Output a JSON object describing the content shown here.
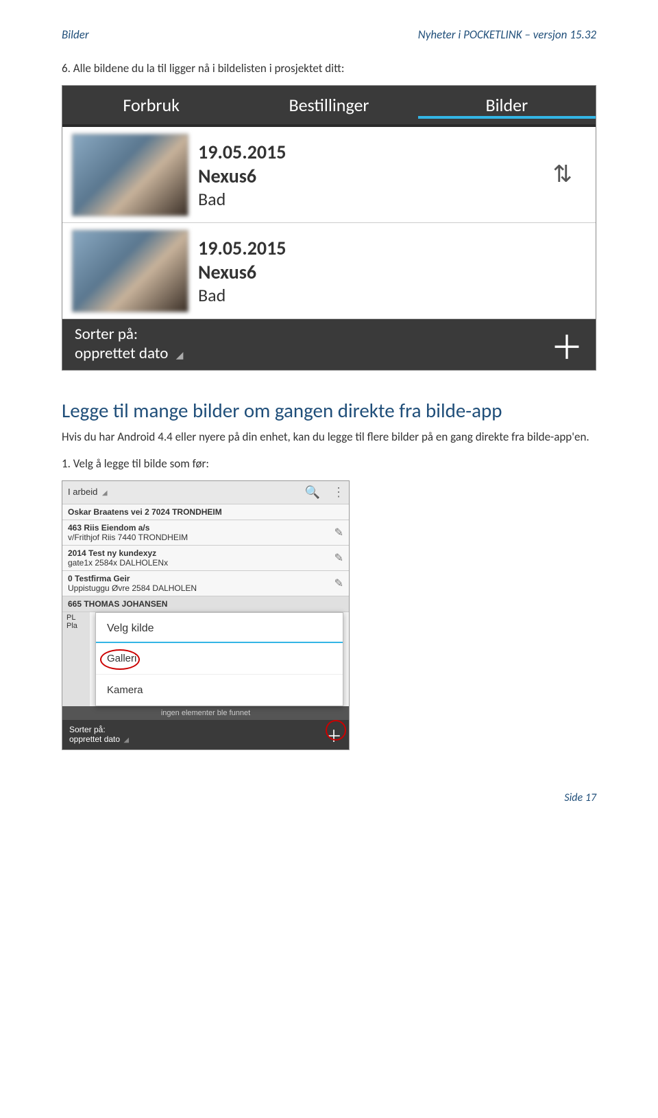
{
  "header": {
    "left": "Bilder",
    "right": "Nyheter i POCKETLINK – versjon 15.32"
  },
  "step6": "6.   Alle bildene du la til ligger nå i bildelisten i prosjektet ditt:",
  "screenshot1": {
    "tabs": {
      "t1": "Forbruk",
      "t2": "Bestillinger",
      "t3": "Bilder"
    },
    "items": [
      {
        "date": "19.05.2015",
        "device": "Nexus6",
        "room": "Bad"
      },
      {
        "date": "19.05.2015",
        "device": "Nexus6",
        "room": "Bad"
      }
    ],
    "sort_icon": "⇅",
    "footer": {
      "sort_label_line1": "Sorter på:",
      "sort_label_line2": "opprettet dato",
      "plus": "＋"
    }
  },
  "heading": "Legge til mange bilder om gangen direkte fra bilde-app",
  "para": "Hvis du har Android 4.4 eller nyere på din enhet, kan du legge til flere bilder på en gang direkte fra bilde-app'en.",
  "step1": "1.   Velg å legge til bilde som før:",
  "screenshot2": {
    "status": "I arbeid",
    "rows": [
      {
        "line1": "Oskar Braatens vei 2  7024  TRONDHEIM",
        "line2": ""
      },
      {
        "line1": "463  Riis Eiendom a/s",
        "line2": "v/Frithjof Riis  7440  TRONDHEIM"
      },
      {
        "line1": "2014  Test ny kundexyz",
        "line2": "gate1x  2584x  DALHOLENx"
      },
      {
        "line1": "0  Testfirma Geir",
        "line2": "Uppistuggu Øvre  2584  DALHOLEN"
      },
      {
        "line1": "665  THOMAS JOHANSEN",
        "line2": ""
      }
    ],
    "pl_a": "PL",
    "pl_b": "Pla",
    "dialog": {
      "title": "Velg kilde",
      "opt1": "Galleri",
      "opt2": "Kamera"
    },
    "extra": "ingen elementer ble funnet",
    "footer": {
      "sort1": "Sorter på:",
      "sort2": "opprettet dato",
      "plus": "＋"
    }
  },
  "page_footer": "Side 17"
}
